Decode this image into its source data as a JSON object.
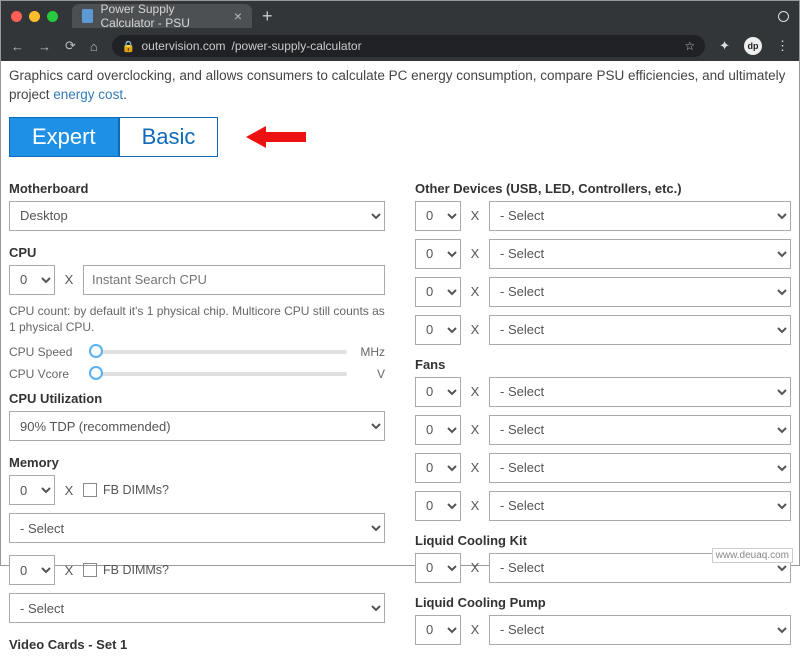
{
  "browser": {
    "tab_title": "Power Supply Calculator - PSU",
    "url_display_host": "outervision.com",
    "url_display_path": "/power-supply-calculator"
  },
  "intro": {
    "text_prefix": "Graphics card overclocking, and allows consumers to calculate PC energy consumption, compare PSU efficiencies, and ultimately project ",
    "link_text": "energy cost",
    "text_suffix": "."
  },
  "tabs": {
    "expert": "Expert",
    "basic": "Basic"
  },
  "left": {
    "motherboard": {
      "label": "Motherboard",
      "value": "Desktop"
    },
    "cpu": {
      "label": "CPU",
      "count": "0",
      "x": "X",
      "placeholder": "Instant Search CPU",
      "note": "CPU count: by default it's 1 physical chip. Multicore CPU still counts as 1 physical CPU.",
      "speed_label": "CPU Speed",
      "speed_unit": "MHz",
      "vcore_label": "CPU Vcore",
      "vcore_unit": "V"
    },
    "cpu_util": {
      "label": "CPU Utilization",
      "value": "90% TDP (recommended)"
    },
    "memory": {
      "label": "Memory",
      "rows": [
        {
          "count": "0",
          "x": "X",
          "cb": "FB DIMMs?",
          "select": "- Select"
        },
        {
          "count": "0",
          "x": "X",
          "cb": "FB DIMMs?",
          "select": "- Select"
        }
      ]
    },
    "video_label": "Video Cards - Set 1"
  },
  "right": {
    "other": {
      "label": "Other Devices (USB, LED, Controllers, etc.)",
      "rows": [
        {
          "count": "0",
          "x": "X",
          "select": "- Select"
        },
        {
          "count": "0",
          "x": "X",
          "select": "- Select"
        },
        {
          "count": "0",
          "x": "X",
          "select": "- Select"
        },
        {
          "count": "0",
          "x": "X",
          "select": "- Select"
        }
      ]
    },
    "fans": {
      "label": "Fans",
      "rows": [
        {
          "count": "0",
          "x": "X",
          "select": "- Select"
        },
        {
          "count": "0",
          "x": "X",
          "select": "- Select"
        },
        {
          "count": "0",
          "x": "X",
          "select": "- Select"
        },
        {
          "count": "0",
          "x": "X",
          "select": "- Select"
        }
      ]
    },
    "liquid_kit": {
      "label": "Liquid Cooling Kit",
      "rows": [
        {
          "count": "0",
          "x": "X",
          "select": "- Select"
        }
      ]
    },
    "liquid_pump": {
      "label": "Liquid Cooling Pump",
      "rows": [
        {
          "count": "0",
          "x": "X",
          "select": "- Select"
        }
      ]
    }
  },
  "watermark": "www.deuaq.com"
}
